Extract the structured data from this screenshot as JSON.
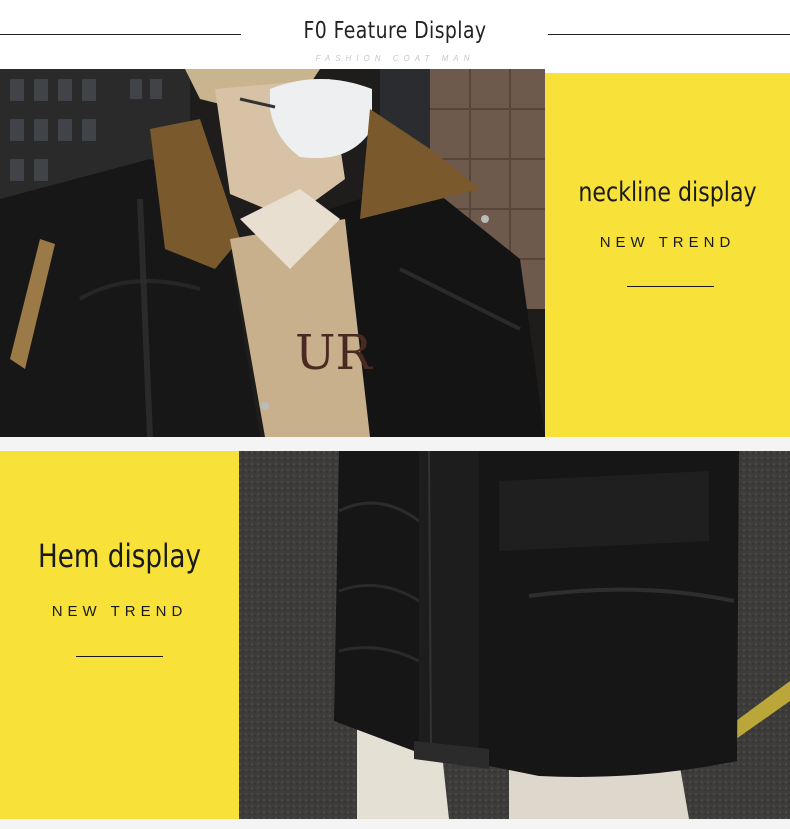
{
  "header": {
    "title": "F0 Feature Display",
    "subtitle": "FASHION COAT MAN"
  },
  "panels": {
    "neckline": {
      "title": "neckline display",
      "subtitle": "NEW TREND"
    },
    "hem": {
      "title": "Hem display",
      "subtitle": "NEW TREND"
    }
  },
  "colors": {
    "accent_yellow": "#f8e239",
    "jacket_black": "#161616",
    "collar_brown": "#7a5a2c",
    "text_dark": "#1a1a1a"
  }
}
